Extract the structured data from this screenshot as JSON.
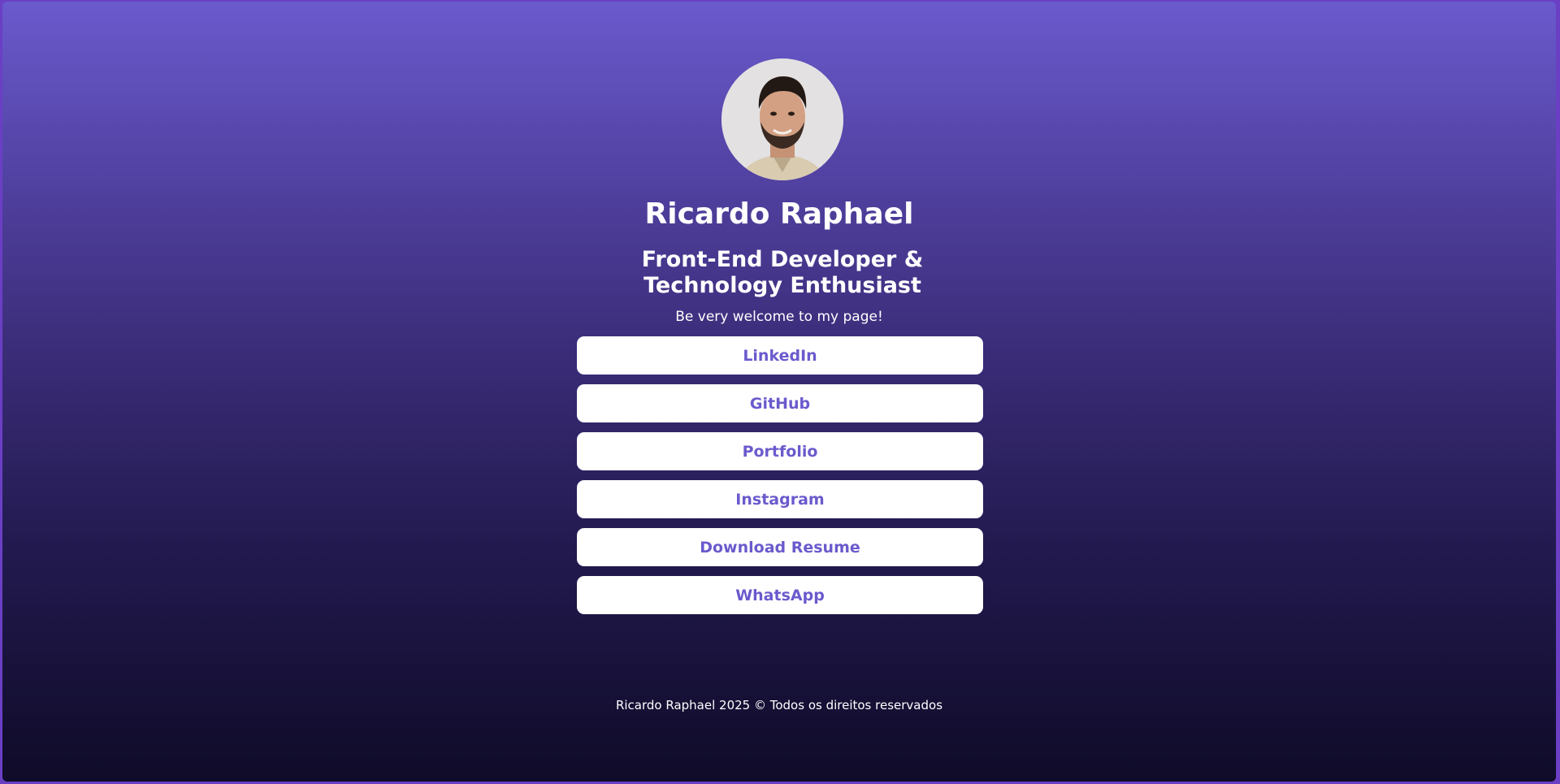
{
  "profile": {
    "avatar_alt": "Ricardo Raphael",
    "name": "Ricardo Raphael",
    "role": "Front-End Developer & Technology Enthusiast",
    "welcome": "Be very welcome to my page!"
  },
  "links": [
    {
      "label": "LinkedIn"
    },
    {
      "label": "GitHub"
    },
    {
      "label": "Portfolio"
    },
    {
      "label": "Instagram"
    },
    {
      "label": "Download Resume"
    },
    {
      "label": "WhatsApp"
    }
  ],
  "footer": {
    "text": "Ricardo Raphael 2025 © Todos os direitos reservados"
  },
  "colors": {
    "gradient_top": "#6a5acd",
    "gradient_bottom": "#0f0b28",
    "button_background": "#ffffff",
    "button_text": "#6a5acd",
    "text": "#ffffff"
  }
}
